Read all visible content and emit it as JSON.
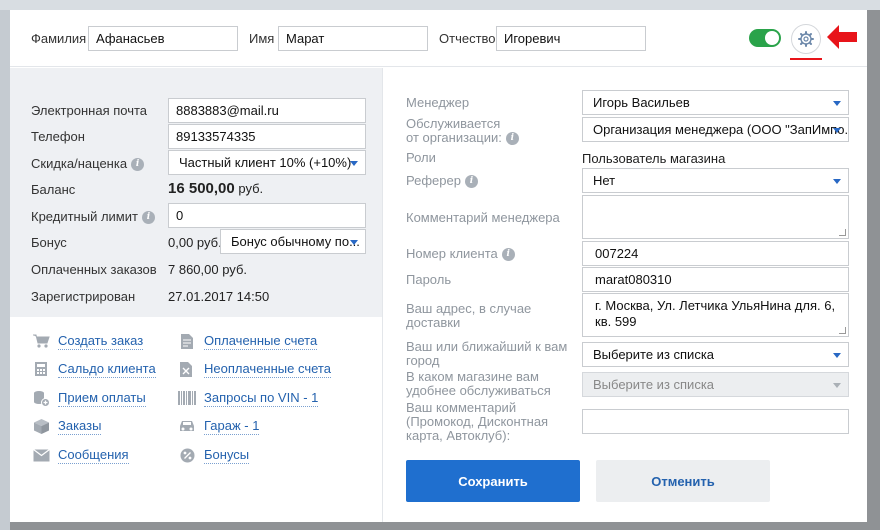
{
  "header": {
    "lastname_label": "Фамилия",
    "lastname_value": "Афанасьев",
    "firstname_label": "Имя",
    "firstname_value": "Марат",
    "patronymic_label": "Отчество",
    "patronymic_value": "Игоревич",
    "toggle_on": true
  },
  "left": {
    "email_label": "Электронная почта",
    "email_value": "8883883@mail.ru",
    "phone_label": "Телефон",
    "phone_value": "89133574335",
    "discount_label": "Скидка/наценка",
    "discount_value": "Частный клиент 10% (+10%)",
    "balance_label": "Баланс",
    "balance_amount": "16 500,00",
    "balance_currency": "руб.",
    "credit_label": "Кредитный лимит",
    "credit_value": "0",
    "bonus_label": "Бонус",
    "bonus_amount": "0,00 руб.",
    "bonus_select": "Бонус обычному по...",
    "paid_orders_label": "Оплаченных заказов",
    "paid_orders_value": "7 860,00 руб.",
    "registered_label": "Зарегистрирован",
    "registered_value": "27.01.2017 14:50"
  },
  "actions": {
    "create_order": "Создать заказ",
    "client_balance": "Сальдо клиента",
    "payment": "Прием оплаты",
    "orders": "Заказы",
    "messages": "Сообщения",
    "paid_invoices": "Оплаченные счета",
    "unpaid_invoices": "Неоплаченные счета",
    "vin_requests": "Запросы по VIN - 1",
    "garage": "Гараж - 1",
    "bonuses": "Бонусы"
  },
  "right": {
    "manager_label": "Менеджер",
    "manager_value": "Игорь Васильев",
    "served_label_1": "Обслуживается",
    "served_label_2": "от организации:",
    "served_value": "Организация менеджера (ООО \"ЗапИмпо...",
    "roles_label": "Роли",
    "roles_value": "Пользователь магазина",
    "referrer_label": "Реферер",
    "referrer_value": "Нет",
    "manager_comment_label": "Комментарий менеджера",
    "manager_comment_value": "",
    "client_number_label": "Номер клиента",
    "client_number_value": "007224",
    "password_label": "Пароль",
    "password_value": "marat080310",
    "address_label_1": "Ваш адрес, в случае",
    "address_label_2": "доставки",
    "address_value_1": "г. Москва, Ул. Летчика УльяНина для. 6,",
    "address_value_2": "кв. 599",
    "city_label_1": "Ваш или ближайший к вам",
    "city_label_2": "город",
    "city_value": "Выберите из списка",
    "store_label_1": "В каком магазине вам",
    "store_label_2": "удобнее обслуживаться",
    "store_value": "Выберите из списка",
    "comment_label_1": "Ваш комментарий",
    "comment_label_2": "(Промокод, Дисконтная",
    "comment_label_3": "карта, Автоклуб):",
    "comment_value": ""
  },
  "buttons": {
    "save": "Сохранить",
    "cancel": "Отменить"
  },
  "colors": {
    "primary": "#1f6fcf",
    "toggle": "#2aa34a",
    "arrow": "#e8141a",
    "link": "#2462ae"
  }
}
